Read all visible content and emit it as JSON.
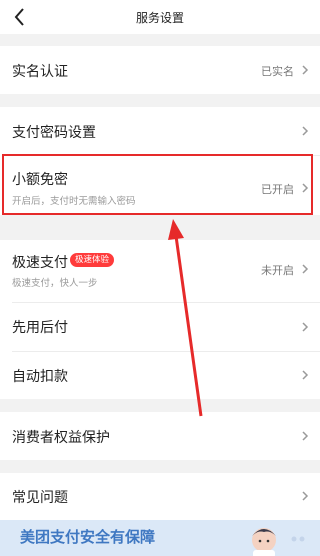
{
  "header": {
    "title": "服务设置"
  },
  "rows": {
    "real_name": {
      "label": "实名认证",
      "value": "已实名"
    },
    "pay_password": {
      "label": "支付密码设置"
    },
    "small_free": {
      "label": "小额免密",
      "sub": "开启后，支付时无需输入密码",
      "value": "已开启"
    },
    "fast_pay": {
      "label": "极速支付",
      "badge": "极速体验",
      "sub": "极速支付，快人一步",
      "value": "未开启"
    },
    "pay_later": {
      "label": "先用后付"
    },
    "auto_debit": {
      "label": "自动扣款"
    },
    "consumer_rights": {
      "label": "消费者权益保护"
    },
    "faq": {
      "label": "常见问题"
    }
  },
  "banner": {
    "text": "美团支付安全有保障"
  },
  "colors": {
    "highlight": "#e62a2a",
    "badge": "#ff3b3b",
    "banner_bg": "#dbe8f7",
    "banner_text": "#3f78c2"
  },
  "icons": [
    "back-arrow-icon",
    "chevron-right-icon"
  ]
}
